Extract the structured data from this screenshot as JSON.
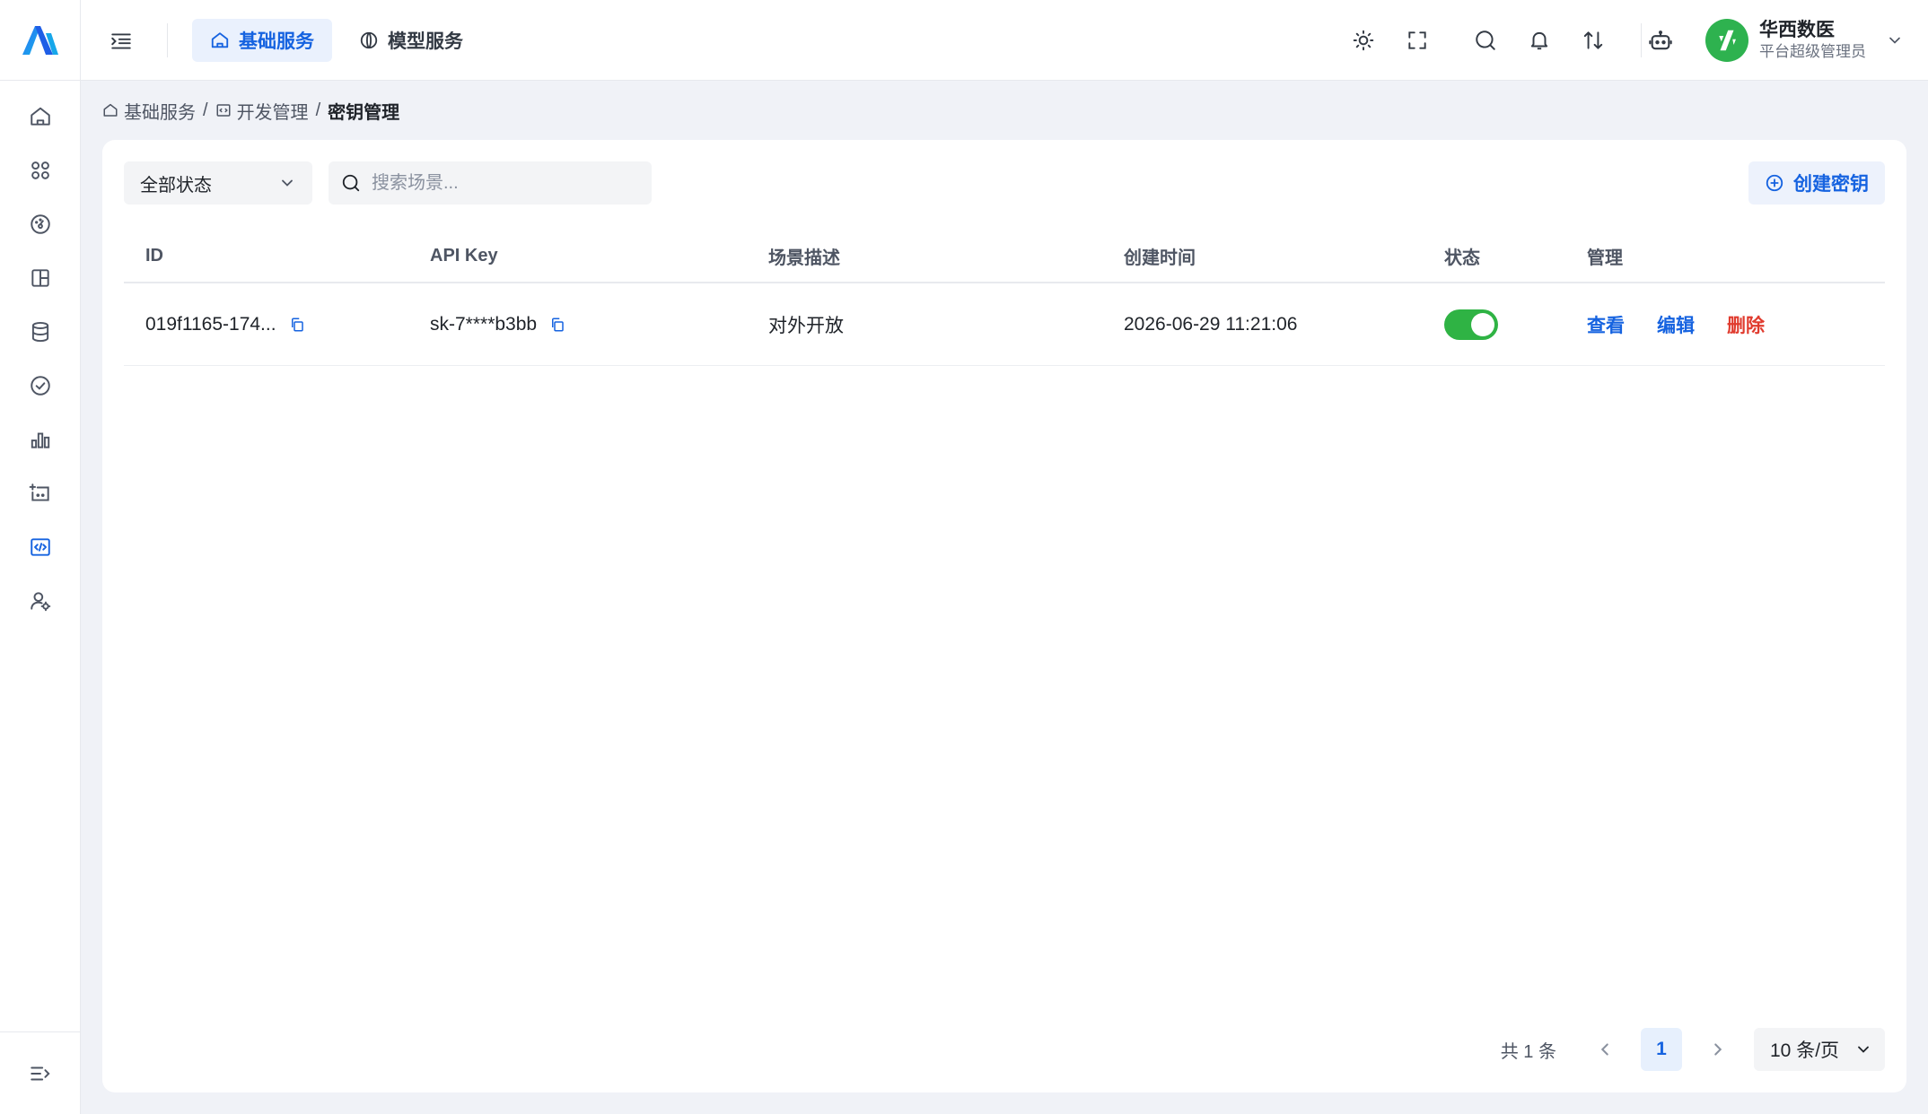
{
  "colors": {
    "accent": "#1663e0",
    "danger": "#e03b2e",
    "toggle_on": "#2fb344",
    "avatar_bg": "#2eb24f"
  },
  "sidebar": {
    "items": [
      {
        "icon": "home-icon"
      },
      {
        "icon": "apps-grid-icon"
      },
      {
        "icon": "dashboard-gauge-icon"
      },
      {
        "icon": "layout-panel-icon"
      },
      {
        "icon": "database-icon"
      },
      {
        "icon": "check-circle-icon"
      },
      {
        "icon": "bar-chart-icon"
      },
      {
        "icon": "add-device-icon"
      },
      {
        "icon": "code-icon",
        "active": true
      },
      {
        "icon": "user-settings-icon"
      }
    ],
    "bottom_icon": "expand-menu-icon"
  },
  "header": {
    "tabs": [
      {
        "label": "基础服务",
        "icon": "home-icon",
        "active": true
      },
      {
        "label": "模型服务",
        "icon": "model-icon",
        "active": false
      }
    ],
    "right_icons": [
      "theme-sun-icon",
      "fullscreen-icon",
      "search-icon",
      "bell-icon",
      "sort-arrows-icon",
      "robot-icon"
    ],
    "user": {
      "name": "华西数医",
      "role": "平台超级管理员"
    }
  },
  "breadcrumb": {
    "items": [
      "基础服务",
      "开发管理",
      "密钥管理"
    ],
    "separator": "/"
  },
  "filters": {
    "status_select": "全部状态",
    "search_placeholder": "搜索场景...",
    "create_label": "创建密钥"
  },
  "table": {
    "columns": {
      "id": "ID",
      "key": "API Key",
      "desc": "场景描述",
      "time": "创建时间",
      "status": "状态",
      "manage": "管理"
    },
    "rows": [
      {
        "id": "019f1165-174...",
        "key": "sk-7****b3bb",
        "desc": "对外开放",
        "time": "2026-06-29 11:21:06",
        "status_on": true,
        "actions": {
          "view": "查看",
          "edit": "编辑",
          "delete": "删除"
        }
      }
    ]
  },
  "pagination": {
    "total_text": "共 1 条",
    "current_page": "1",
    "page_size": "10 条/页"
  }
}
